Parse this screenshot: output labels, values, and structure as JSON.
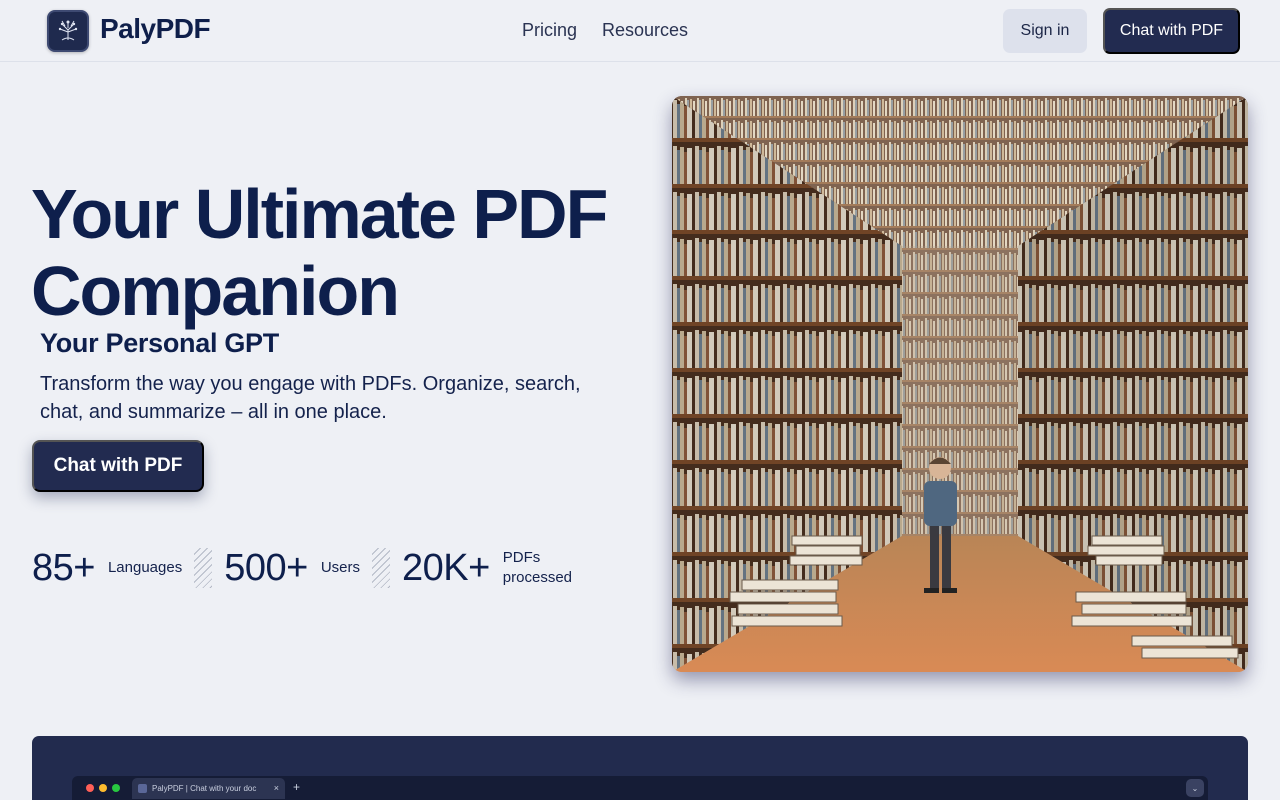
{
  "header": {
    "brand": "PalyPDF",
    "nav": {
      "pricing": "Pricing",
      "resources": "Resources"
    },
    "sign_in": "Sign in",
    "cta": "Chat with PDF"
  },
  "hero": {
    "title_line1": "Your Ultimate PDF",
    "title_line2": "Companion",
    "subtitle": "Your Personal GPT",
    "description": "Transform the way you engage with PDFs. Organize, search, chat, and summarize – all in one place.",
    "cta": "Chat with PDF",
    "image_icon": "library-illustration"
  },
  "stats": [
    {
      "value": "85+",
      "label": "Languages"
    },
    {
      "value": "500+",
      "label": "Users"
    },
    {
      "value": "20K+",
      "label": "PDFs processed"
    }
  ],
  "preview": {
    "tab_title": "PalyPDF | Chat with your doc",
    "tab_close": "×",
    "tab_add": "+",
    "menu_icon": "⌄"
  },
  "colors": {
    "background": "#eef0f5",
    "primary": "#222b50",
    "text": "#0e1f4c"
  }
}
